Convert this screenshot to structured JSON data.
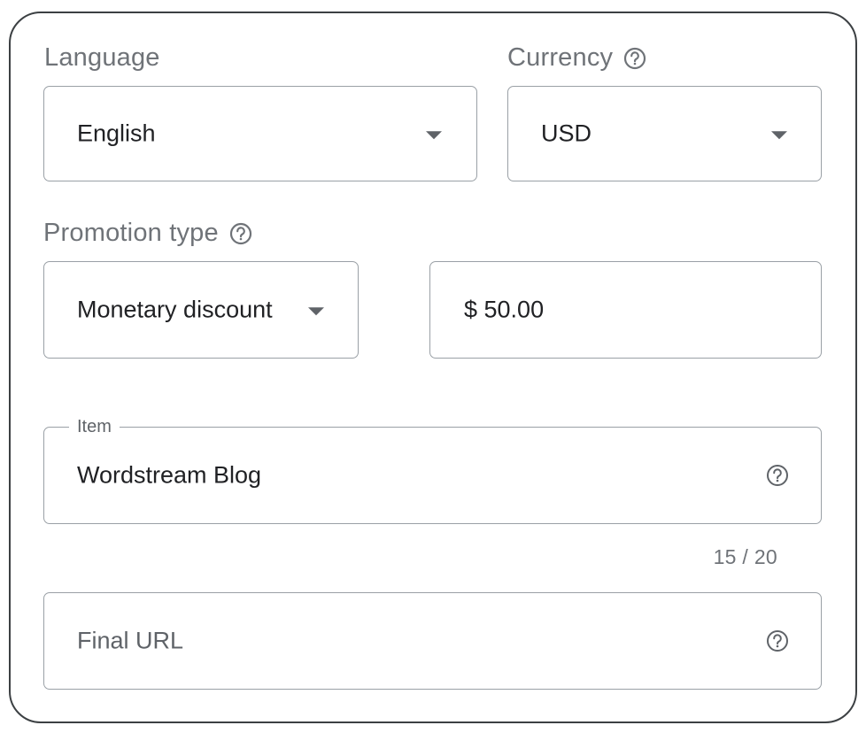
{
  "language": {
    "label": "Language",
    "value": "English",
    "dropdown_icon": "caret-down-icon"
  },
  "currency": {
    "label": "Currency",
    "help_icon": "help-circle-icon",
    "value": "USD",
    "dropdown_icon": "caret-down-icon"
  },
  "promotion_type": {
    "label": "Promotion type",
    "help_icon": "help-circle-icon",
    "value": "Monetary discount",
    "dropdown_icon": "caret-down-icon"
  },
  "discount_amount": {
    "value": "$ 50.00"
  },
  "item": {
    "label": "Item",
    "value": "Wordstream Blog",
    "help_icon": "help-circle-icon",
    "counter": "15 / 20"
  },
  "final_url": {
    "placeholder": "Final URL",
    "help_icon": "help-circle-icon"
  },
  "colors": {
    "border": "#9aa0a6",
    "text": "#202124",
    "label": "#6f7378",
    "icon": "#5f6368",
    "card_border": "#3c4043"
  }
}
